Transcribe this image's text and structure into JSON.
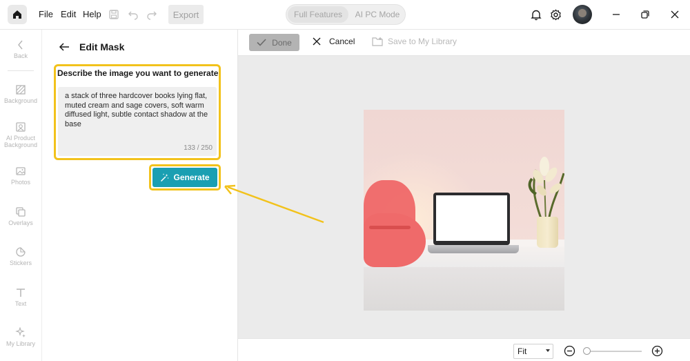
{
  "menu": {
    "file": "File",
    "edit": "Edit",
    "help": "Help",
    "export": "Export"
  },
  "modes": {
    "full": "Full Features",
    "ai_pc": "AI PC Mode"
  },
  "rail": [
    {
      "label": "Back",
      "icon": "chevron-left-icon"
    },
    {
      "label": "Background",
      "icon": "background-icon"
    },
    {
      "label": "AI Product Background",
      "icon": "ai-product-icon"
    },
    {
      "label": "Photos",
      "icon": "photo-icon"
    },
    {
      "label": "Overlays",
      "icon": "overlays-icon"
    },
    {
      "label": "Stickers",
      "icon": "sticker-icon"
    },
    {
      "label": "Text",
      "icon": "text-icon"
    },
    {
      "label": "My Library",
      "icon": "library-icon"
    }
  ],
  "panel": {
    "title": "Edit Mask",
    "prompt_label": "Describe the image you want to generate",
    "prompt_value": "a stack of three hardcover books lying flat, muted cream and sage covers, soft warm diffused light, subtle contact shadow at the base",
    "char_count": "133 / 250",
    "generate_label": "Generate"
  },
  "canvas_toolbar": {
    "done": "Done",
    "cancel": "Cancel",
    "save": "Save to My Library"
  },
  "bottom": {
    "fit": "Fit"
  },
  "colors": {
    "accent": "#1a9fb2",
    "highlight": "#f2c21b",
    "mask": "#ef6a6a"
  }
}
